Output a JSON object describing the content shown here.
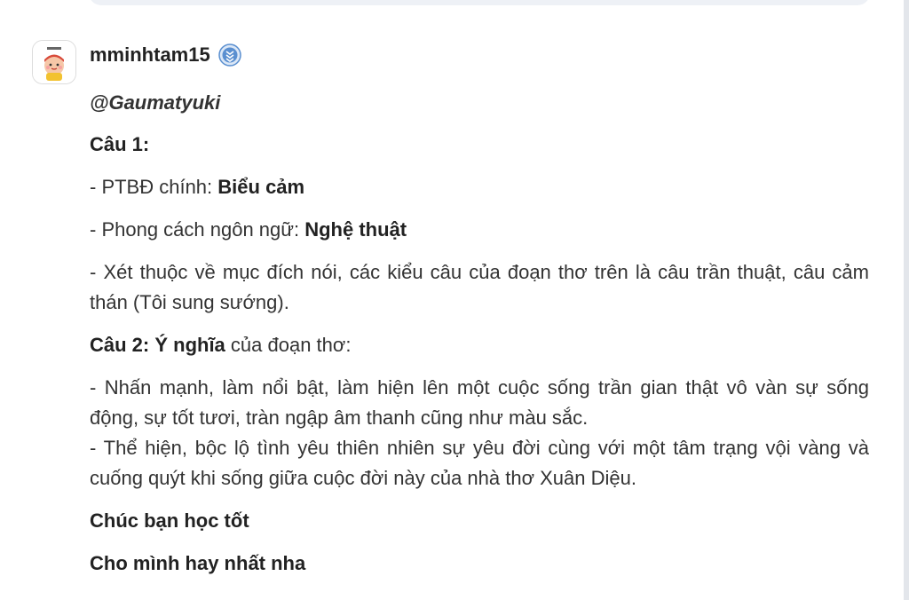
{
  "post": {
    "username": "mminhtam15",
    "badge_icon": "rank-badge-icon",
    "avatar_icon": "cartoon-avatar-icon",
    "mention": "@Gaumatyuki",
    "q1_heading": "Câu 1:",
    "ptbd_prefix": "- PTBĐ chính: ",
    "ptbd_value": "Biểu cảm",
    "style_prefix": "- Phong cách ngôn ngữ: ",
    "style_value": "Nghệ thuật",
    "sentence_types": "- Xét thuộc về mục đích nói, các kiểu câu của đoạn thơ trên là câu trần thuật, câu cảm thán (Tôi sung sướng).",
    "q2_label": "Câu 2: Ý nghĩa",
    "q2_rest": " của đoạn thơ:",
    "meaning_1": "- Nhấn mạnh, làm nổi bật, làm hiện lên một cuộc sống trần gian thật vô vàn sự sống động, sự tốt tươi, tràn ngập âm thanh cũng như màu sắc.",
    "meaning_2": "- Thể hiện, bộc lộ tình yêu thiên nhiên sự yêu đời cùng với một tâm trạng vội vàng và cuống quýt khi sống giữa cuộc đời này của nhà thơ Xuân Diệu.",
    "closing_1": "Chúc bạn học tốt",
    "closing_2": "Cho mình hay nhất nha"
  },
  "colors": {
    "text": "#333333",
    "badge": "#5a8fd0",
    "top_card": "#eef1f6"
  }
}
